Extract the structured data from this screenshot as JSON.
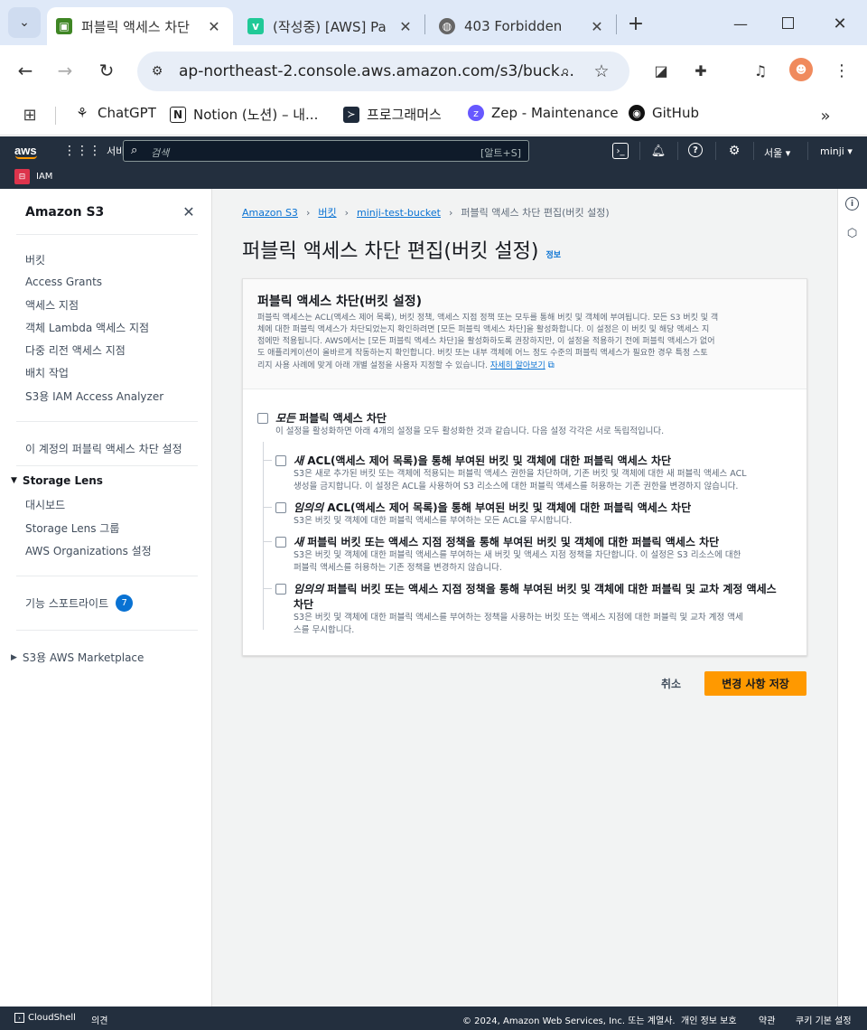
{
  "browser": {
    "tabs": [
      {
        "title": "퍼블릭 액세스 차단",
        "icon": "aws-s3-favicon",
        "active": true
      },
      {
        "title": "(작성중) [AWS] Pa",
        "icon": "velog-favicon",
        "active": false
      },
      {
        "title": "403 Forbidden",
        "icon": "globe-icon",
        "active": false
      }
    ],
    "url": "ap-northeast-2.console.aws.amazon.com/s3/buck...",
    "bookmarks": [
      {
        "label": "ChatGPT",
        "icon": "chatgpt-icon"
      },
      {
        "label": "Notion (노션) – 내...",
        "icon": "notion-icon"
      },
      {
        "label": "프로그래머스",
        "icon": "programmers-icon"
      },
      {
        "label": "Zep - Maintenance",
        "icon": "zep-icon"
      },
      {
        "label": "GitHub",
        "icon": "github-icon"
      }
    ]
  },
  "aws": {
    "logo": "aws",
    "services_label": "서비스",
    "search_placeholder": "검색",
    "search_shortcut": "[알트+S]",
    "region": "서울 ▾",
    "user": "minji ▾",
    "service_badge": "IAM"
  },
  "sidebar": {
    "title": "Amazon S3",
    "items": [
      "버킷",
      "Access Grants",
      "액세스 지점",
      "객체 Lambda 액세스 지점",
      "다중 리전 액세스 지점",
      "배치 작업",
      "S3용 IAM Access Analyzer"
    ],
    "account_block": "이 계정의 퍼블릭 액세스 차단 설정",
    "storage_lens": {
      "title": "Storage Lens",
      "items": [
        "대시보드",
        "Storage Lens 그룹",
        "AWS Organizations 설정"
      ]
    },
    "feature_spotlight": "기능 스포트라이트",
    "feature_count": "7",
    "marketplace": "S3용 AWS Marketplace"
  },
  "breadcrumb": [
    "Amazon S3",
    "버킷",
    "minji-test-bucket",
    "퍼블릭 액세스 차단 편집(버킷 설정)"
  ],
  "page": {
    "title": "퍼블릭 액세스 차단 편집(버킷 설정)",
    "info": "정보"
  },
  "panel": {
    "title": "퍼블릭 액세스 차단(버킷 설정)",
    "desc_lines": [
      "퍼블릭 액세스는 ACL(액세스 제어 목록), 버킷 정책, 액세스 지점 정책 또는 모두를 통해 버킷 및 객체에 부여됩니다. 모든 S3 버킷 및 객",
      "체에 대한 퍼블릭 액세스가 차단되었는지 확인하려면 [모든 퍼블릭 액세스 차단]을 활성화합니다. 이 설정은 이 버킷 및 해당 액세스 지",
      "점에만 적용됩니다. AWS에서는 [모든 퍼블릭 액세스 차단]을 활성화하도록 권장하지만, 이 설정을 적용하기 전에 퍼블릭 액세스가 없어",
      "도 애플리케이션이 올바르게 작동하는지 확인합니다. 버킷 또는 내부 객체에 어느 정도 수준의 퍼블릭 액세스가 필요한 경우 특정 스토",
      "리지 사용 사례에 맞게 아래 개별 설정을 사용자 지정할 수 있습니다."
    ],
    "learn_more": "자세히 알아보기",
    "all": {
      "em": "모든",
      "title": " 퍼블릭 액세스 차단",
      "desc": "이 설정을 활성화하면 아래 4개의 설정을 모두 활성화한 것과 같습니다. 다음 설정 각각은 서로 독립적입니다."
    },
    "options": [
      {
        "em": "새",
        "title": " ACL(액세스 제어 목록)을 통해 부여된 버킷 및 객체에 대한 퍼블릭 액세스 차단",
        "desc": [
          "S3은 새로 추가된 버킷 또는 객체에 적용되는 퍼블릭 액세스 권한을 차단하며, 기존 버킷 및 객체에 대한 새 퍼블릭 액세스 ACL",
          "생성을 금지합니다. 이 설정은 ACL을 사용하여 S3 리소스에 대한 퍼블릭 액세스를 허용하는 기존 권한을 변경하지 않습니다."
        ]
      },
      {
        "em": "임의의",
        "title": " ACL(액세스 제어 목록)을 통해 부여된 버킷 및 객체에 대한 퍼블릭 액세스 차단",
        "desc": [
          "S3은 버킷 및 객체에 대한 퍼블릭 액세스를 부여하는 모든 ACL을 무시합니다."
        ]
      },
      {
        "em": "새",
        "title": " 퍼블릭 버킷 또는 액세스 지점 정책을 통해 부여된 버킷 및 객체에 대한 퍼블릭 액세스 차단",
        "desc": [
          "S3은 버킷 및 객체에 대한 퍼블릭 액세스를 부여하는 새 버킷 및 액세스 지점 정책을 차단합니다. 이 설정은 S3 리소스에 대한",
          "퍼블릭 액세스를 허용하는 기존 정책을 변경하지 않습니다."
        ]
      },
      {
        "em": "임의의",
        "title": " 퍼블릭 버킷 또는 액세스 지점 정책을 통해 부여된 버킷 및 객체에 대한 퍼블릭 및 교차 계정 액세스",
        "title2": "차단",
        "desc": [
          "S3은 버킷 및 객체에 대한 퍼블릭 액세스를 부여하는 정책을 사용하는 버킷 또는 액세스 지점에 대한 퍼블릭 및 교차 계정 액세",
          "스를 무시합니다."
        ]
      }
    ]
  },
  "actions": {
    "cancel": "취소",
    "save": "변경 사항 저장"
  },
  "footer": {
    "cloudshell": "CloudShell",
    "feedback": "의견",
    "copyright": "© 2024, Amazon Web Services, Inc. 또는 계열사.",
    "privacy": "개인 정보 보호",
    "terms": "약관",
    "cookies": "쿠키 기본 설정"
  },
  "colors": {
    "aws_nav": "#232f3e",
    "primary": "#ff9900",
    "link": "#0972d3",
    "badge": "#0972d3"
  }
}
